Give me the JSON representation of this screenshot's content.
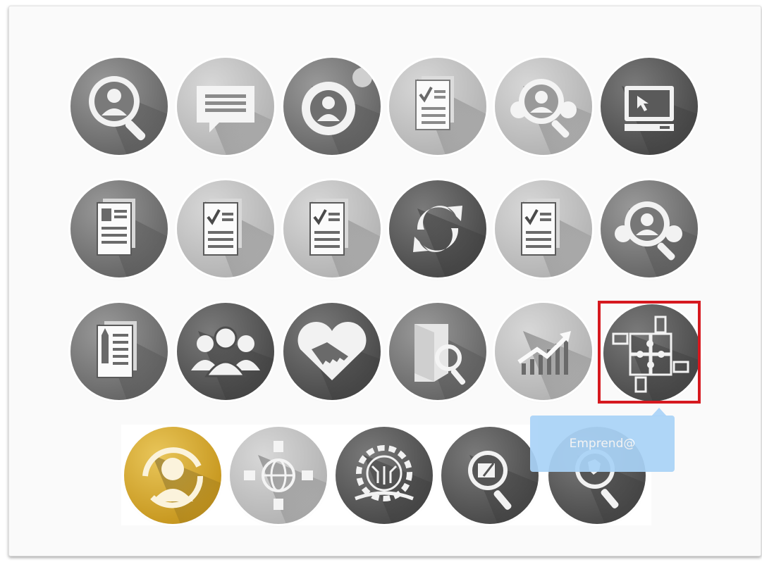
{
  "tooltip": {
    "label": "Emprend@"
  },
  "colors": {
    "selection": "#d6191f",
    "tooltip_bg": "#a9d3f7",
    "gold_tile": "#c99a22"
  },
  "icons": [
    {
      "name": "person-search-icon"
    },
    {
      "name": "chat-message-icon"
    },
    {
      "name": "user-settings-gear-icon"
    },
    {
      "name": "checklist-document-icon"
    },
    {
      "name": "people-search-icon"
    },
    {
      "name": "computer-cursor-icon"
    },
    {
      "name": "document-pages-icon"
    },
    {
      "name": "checklist-document-icon"
    },
    {
      "name": "checklist-document-icon"
    },
    {
      "name": "refresh-sync-icon"
    },
    {
      "name": "checklist-document-icon"
    },
    {
      "name": "people-search-icon"
    },
    {
      "name": "document-pencil-icon"
    },
    {
      "name": "group-people-icon"
    },
    {
      "name": "handshake-heart-icon"
    },
    {
      "name": "folder-search-icon"
    },
    {
      "name": "growth-chart-icon"
    },
    {
      "name": "puzzle-hands-icon"
    },
    {
      "name": "user-rotate-icon"
    },
    {
      "name": "global-network-hands-icon"
    },
    {
      "name": "innovation-gear-icon"
    },
    {
      "name": "search-edit-icon"
    },
    {
      "name": "map-search-icon"
    }
  ]
}
